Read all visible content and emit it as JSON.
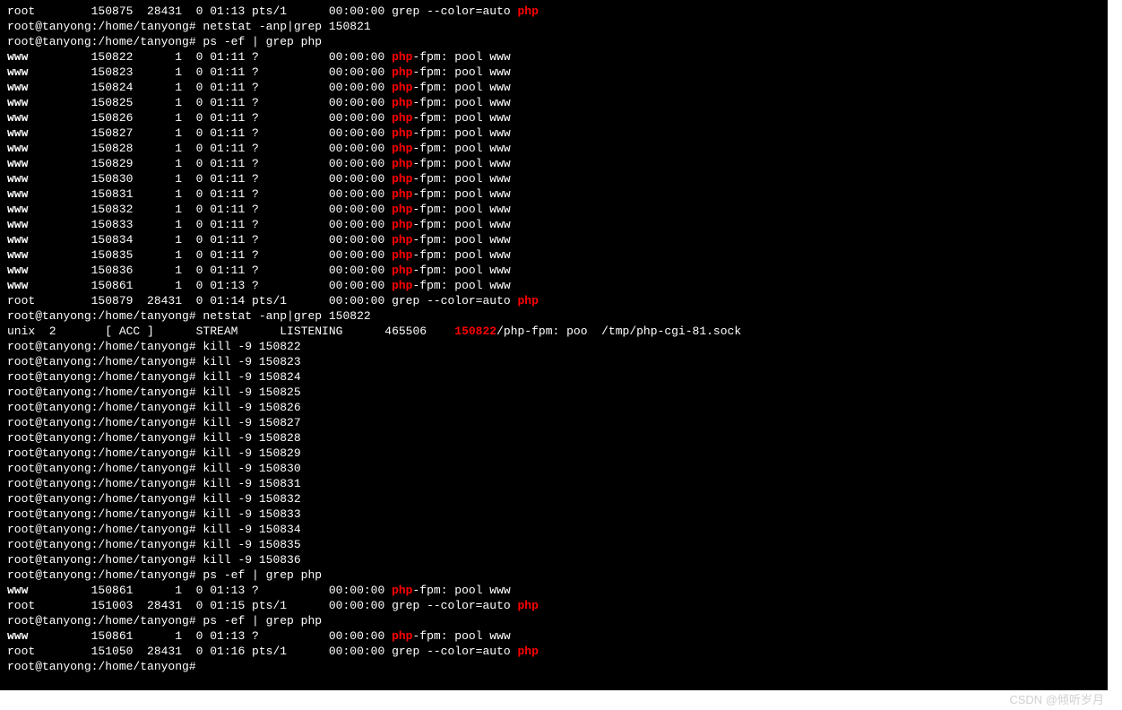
{
  "prompt": "root@tanyong:/home/tanyong#",
  "grep_header": {
    "user": "root",
    "pid": "150875",
    "ppid": "28431",
    "c": "0",
    "stime": "01:13",
    "tty": "pts/1",
    "time": "00:00:00",
    "cmd_pre": "grep --color=auto ",
    "cmd_hl": "php"
  },
  "cmd_netstat1": "netstat -anp|grep 150821",
  "cmd_ps1": "ps -ef | grep php",
  "ps_rows1": [
    {
      "user": "www",
      "pid": "150822",
      "ppid": "1",
      "c": "0",
      "stime": "01:11",
      "tty": "?",
      "time": "00:00:00",
      "hl": "php",
      "rest": "-fpm: pool www"
    },
    {
      "user": "www",
      "pid": "150823",
      "ppid": "1",
      "c": "0",
      "stime": "01:11",
      "tty": "?",
      "time": "00:00:00",
      "hl": "php",
      "rest": "-fpm: pool www"
    },
    {
      "user": "www",
      "pid": "150824",
      "ppid": "1",
      "c": "0",
      "stime": "01:11",
      "tty": "?",
      "time": "00:00:00",
      "hl": "php",
      "rest": "-fpm: pool www"
    },
    {
      "user": "www",
      "pid": "150825",
      "ppid": "1",
      "c": "0",
      "stime": "01:11",
      "tty": "?",
      "time": "00:00:00",
      "hl": "php",
      "rest": "-fpm: pool www"
    },
    {
      "user": "www",
      "pid": "150826",
      "ppid": "1",
      "c": "0",
      "stime": "01:11",
      "tty": "?",
      "time": "00:00:00",
      "hl": "php",
      "rest": "-fpm: pool www"
    },
    {
      "user": "www",
      "pid": "150827",
      "ppid": "1",
      "c": "0",
      "stime": "01:11",
      "tty": "?",
      "time": "00:00:00",
      "hl": "php",
      "rest": "-fpm: pool www"
    },
    {
      "user": "www",
      "pid": "150828",
      "ppid": "1",
      "c": "0",
      "stime": "01:11",
      "tty": "?",
      "time": "00:00:00",
      "hl": "php",
      "rest": "-fpm: pool www"
    },
    {
      "user": "www",
      "pid": "150829",
      "ppid": "1",
      "c": "0",
      "stime": "01:11",
      "tty": "?",
      "time": "00:00:00",
      "hl": "php",
      "rest": "-fpm: pool www"
    },
    {
      "user": "www",
      "pid": "150830",
      "ppid": "1",
      "c": "0",
      "stime": "01:11",
      "tty": "?",
      "time": "00:00:00",
      "hl": "php",
      "rest": "-fpm: pool www"
    },
    {
      "user": "www",
      "pid": "150831",
      "ppid": "1",
      "c": "0",
      "stime": "01:11",
      "tty": "?",
      "time": "00:00:00",
      "hl": "php",
      "rest": "-fpm: pool www"
    },
    {
      "user": "www",
      "pid": "150832",
      "ppid": "1",
      "c": "0",
      "stime": "01:11",
      "tty": "?",
      "time": "00:00:00",
      "hl": "php",
      "rest": "-fpm: pool www"
    },
    {
      "user": "www",
      "pid": "150833",
      "ppid": "1",
      "c": "0",
      "stime": "01:11",
      "tty": "?",
      "time": "00:00:00",
      "hl": "php",
      "rest": "-fpm: pool www"
    },
    {
      "user": "www",
      "pid": "150834",
      "ppid": "1",
      "c": "0",
      "stime": "01:11",
      "tty": "?",
      "time": "00:00:00",
      "hl": "php",
      "rest": "-fpm: pool www"
    },
    {
      "user": "www",
      "pid": "150835",
      "ppid": "1",
      "c": "0",
      "stime": "01:11",
      "tty": "?",
      "time": "00:00:00",
      "hl": "php",
      "rest": "-fpm: pool www"
    },
    {
      "user": "www",
      "pid": "150836",
      "ppid": "1",
      "c": "0",
      "stime": "01:11",
      "tty": "?",
      "time": "00:00:00",
      "hl": "php",
      "rest": "-fpm: pool www"
    },
    {
      "user": "www",
      "pid": "150861",
      "ppid": "1",
      "c": "0",
      "stime": "01:13",
      "tty": "?",
      "time": "00:00:00",
      "hl": "php",
      "rest": "-fpm: pool www"
    }
  ],
  "grep_row1": {
    "user": "root",
    "pid": "150879",
    "ppid": "28431",
    "c": "0",
    "stime": "01:14",
    "tty": "pts/1",
    "time": "00:00:00",
    "cmd_pre": "grep --color=auto ",
    "cmd_hl": "php"
  },
  "cmd_netstat2": "netstat -anp|grep 150822",
  "netstat_out": {
    "proto": "unix",
    "refcnt": "2",
    "flags": "[ ACC ]",
    "type": "STREAM",
    "state": "LISTENING",
    "inode": "465506",
    "hl": "150822",
    "rest": "/php-fpm: poo",
    "path": "/tmp/php-cgi-81.sock"
  },
  "kill_cmds": [
    "kill -9 150822",
    "kill -9 150823",
    "kill -9 150824",
    "kill -9 150825",
    "kill -9 150826",
    "kill -9 150827",
    "kill -9 150828",
    "kill -9 150829",
    "kill -9 150830",
    "kill -9 150831",
    "kill -9 150832",
    "kill -9 150833",
    "kill -9 150834",
    "kill -9 150835",
    "kill -9 150836"
  ],
  "cmd_ps2": "ps -ef | grep php",
  "ps_rows2": [
    {
      "user": "www",
      "pid": "150861",
      "ppid": "1",
      "c": "0",
      "stime": "01:13",
      "tty": "?",
      "time": "00:00:00",
      "hl": "php",
      "rest": "-fpm: pool www"
    }
  ],
  "grep_row2": {
    "user": "root",
    "pid": "151003",
    "ppid": "28431",
    "c": "0",
    "stime": "01:15",
    "tty": "pts/1",
    "time": "00:00:00",
    "cmd_pre": "grep --color=auto ",
    "cmd_hl": "php"
  },
  "cmd_ps3": "ps -ef | grep php",
  "ps_rows3": [
    {
      "user": "www",
      "pid": "150861",
      "ppid": "1",
      "c": "0",
      "stime": "01:13",
      "tty": "?",
      "time": "00:00:00",
      "hl": "php",
      "rest": "-fpm: pool www"
    }
  ],
  "grep_row3": {
    "user": "root",
    "pid": "151050",
    "ppid": "28431",
    "c": "0",
    "stime": "01:16",
    "tty": "pts/1",
    "time": "00:00:00",
    "cmd_pre": "grep --color=auto ",
    "cmd_hl": "php"
  },
  "watermark": "CSDN @倾听岁月"
}
